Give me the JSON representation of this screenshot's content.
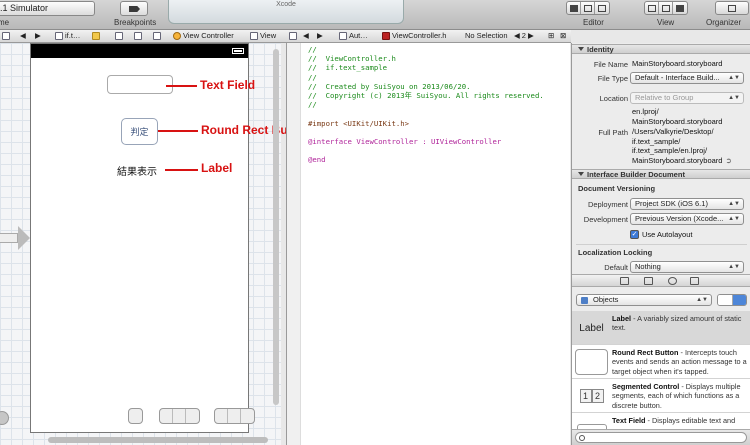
{
  "toolbar": {
    "scheme_text": ".1 Simulator",
    "scheme_caption": "me",
    "breakpoints_label": "Breakpoints",
    "activity_title": "Xcode",
    "editor_label": "Editor",
    "view_label": "View",
    "organizer_label": "Organizer"
  },
  "jumpbar_left": {
    "project": "if.t…",
    "controller": "View Controller",
    "view": "View"
  },
  "jumpbar_right": {
    "auto_item": "Aut…",
    "file": "ViewController.h",
    "selection": "No Selection",
    "count": "2"
  },
  "canvas": {
    "round_rect_button_title": "判定",
    "label_text": "結果表示",
    "annotations": {
      "text_field": "Text Field",
      "round_rect_button": "Round Rect Button",
      "label": "Label"
    }
  },
  "editor": {
    "lines": [
      {
        "cls": "c-comment",
        "text": "//"
      },
      {
        "cls": "c-comment",
        "text": "//  ViewController.h"
      },
      {
        "cls": "c-comment",
        "text": "//  if.text_sample"
      },
      {
        "cls": "c-comment",
        "text": "//"
      },
      {
        "cls": "c-comment",
        "text": "//  Created by SuiSyou on 2013/06/20."
      },
      {
        "cls": "c-comment",
        "text": "//  Copyright (c) 2013年 SuiSyou. All rights reserved."
      },
      {
        "cls": "c-comment",
        "text": "//"
      },
      {
        "cls": "c-plain",
        "text": ""
      },
      {
        "cls": "c-pre",
        "text": "#import <UIKit/UIKit.h>"
      },
      {
        "cls": "c-plain",
        "text": ""
      },
      {
        "cls": "c-kw",
        "text": "@interface ViewController : UIViewController"
      },
      {
        "cls": "c-plain",
        "text": ""
      },
      {
        "cls": "c-kw",
        "text": "@end"
      }
    ]
  },
  "utilities": {
    "identity": {
      "header": "Identity",
      "file_name_label": "File Name",
      "file_name": "MainStoryboard.storyboard",
      "file_type_label": "File Type",
      "file_type": "Default - Interface Build...",
      "location_label": "Location",
      "location": "Relative to Group",
      "location_path": [
        "en.lproj/",
        "MainStoryboard.storyboard"
      ],
      "full_path_label": "Full Path",
      "full_path": [
        "/Users/Valkyrie/Desktop/",
        "if.text_sample/",
        "if.text_sample/en.lproj/",
        "MainStoryboard.storyboard"
      ]
    },
    "ib_document": {
      "header": "Interface Builder Document",
      "versioning_title": "Document Versioning",
      "deployment_label": "Deployment",
      "deployment": "Project SDK (iOS 6.1)",
      "development_label": "Development",
      "development": "Previous Version (Xcode...",
      "autolayout": "Use Autolayout",
      "localization_title": "Localization Locking",
      "default_label": "Default",
      "default": "Nothing"
    },
    "library": {
      "selector": "Objects",
      "items": [
        {
          "icon_text": "Label",
          "name": "Label",
          "desc": " - A variably sized amount of static text."
        },
        {
          "icon_text": "",
          "name": "Round Rect Button",
          "desc": " - Intercepts touch events and sends an action message to a target object when it's tapped."
        },
        {
          "icon_text": "",
          "name": "Segmented Control",
          "desc": " - Displays multiple segments, each of which functions as a discrete button."
        },
        {
          "icon_text": "",
          "name": "Text Field",
          "desc": " - Displays editable text and"
        }
      ]
    }
  }
}
